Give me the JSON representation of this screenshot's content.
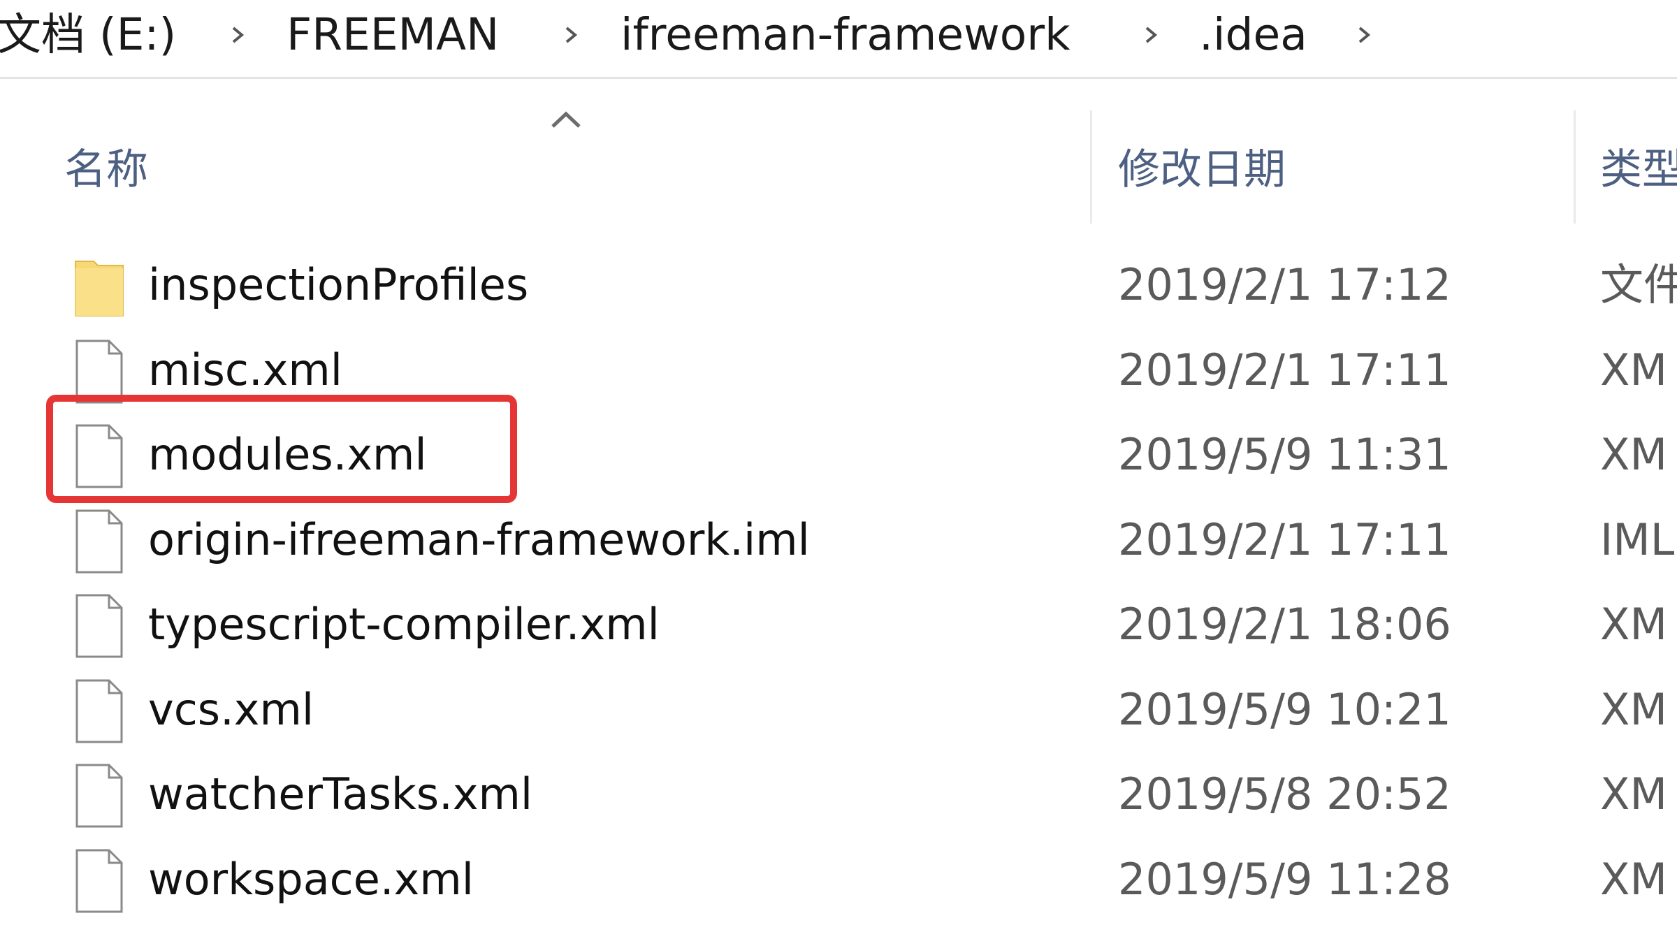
{
  "breadcrumb": {
    "items": [
      "文档 (E:)",
      "FREEMAN",
      "ifreeman-framework",
      ".idea"
    ]
  },
  "columns": {
    "name": "名称",
    "modified": "修改日期",
    "type": "类型"
  },
  "files": [
    {
      "name": "inspectionProfiles",
      "modified": "2019/2/1 17:12",
      "type": "文件",
      "icon": "folder-icon"
    },
    {
      "name": "misc.xml",
      "modified": "2019/2/1 17:11",
      "type": "XM",
      "icon": "file-icon"
    },
    {
      "name": "modules.xml",
      "modified": "2019/5/9 11:31",
      "type": "XM",
      "icon": "file-icon"
    },
    {
      "name": "origin-ifreeman-framework.iml",
      "modified": "2019/2/1 17:11",
      "type": "IML",
      "icon": "file-icon"
    },
    {
      "name": "typescript-compiler.xml",
      "modified": "2019/2/1 18:06",
      "type": "XM",
      "icon": "file-icon"
    },
    {
      "name": "vcs.xml",
      "modified": "2019/5/9 10:21",
      "type": "XM",
      "icon": "file-icon"
    },
    {
      "name": "watcherTasks.xml",
      "modified": "2019/5/8 20:52",
      "type": "XM",
      "icon": "file-icon"
    },
    {
      "name": "workspace.xml",
      "modified": "2019/5/9 11:28",
      "type": "XM",
      "icon": "file-icon"
    }
  ],
  "highlight": {
    "target": "modules.xml",
    "color": "#e63535"
  },
  "colors": {
    "folder": "#f8d775",
    "header_text": "#4d6082"
  }
}
